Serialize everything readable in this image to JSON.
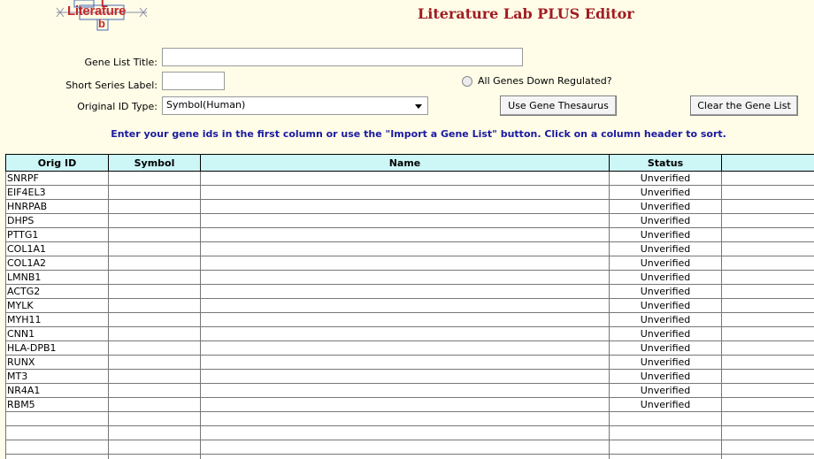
{
  "logo": {
    "word": "Literature",
    "top_letter": "L",
    "bottom_letter": "b"
  },
  "app_title": "Literature Lab PLUS Editor",
  "form": {
    "gene_list_title_label": "Gene List Title:",
    "gene_list_title_value": "",
    "short_series_label": "Short Series Label:",
    "short_series_value": "",
    "original_id_type_label": "Original ID Type:",
    "original_id_type_value": "Symbol(Human)",
    "all_genes_down_label": "All Genes Down Regulated?"
  },
  "buttons": {
    "use_gene_thesaurus": "Use Gene Thesaurus",
    "clear_gene_list": "Clear the Gene List"
  },
  "instruction": "Enter your gene ids in the first column or use the \"Import a Gene List\" button.  Click on a column header to sort.",
  "table": {
    "columns": [
      "Orig ID",
      "Symbol",
      "Name",
      "Status",
      ""
    ],
    "rows": [
      [
        "SNRPF",
        "",
        "",
        "Unverified",
        ""
      ],
      [
        "EIF4EL3",
        "",
        "",
        "Unverified",
        ""
      ],
      [
        "HNRPAB",
        "",
        "",
        "Unverified",
        ""
      ],
      [
        "DHPS",
        "",
        "",
        "Unverified",
        ""
      ],
      [
        "PTTG1",
        "",
        "",
        "Unverified",
        ""
      ],
      [
        "COL1A1",
        "",
        "",
        "Unverified",
        ""
      ],
      [
        "COL1A2",
        "",
        "",
        "Unverified",
        ""
      ],
      [
        "LMNB1",
        "",
        "",
        "Unverified",
        ""
      ],
      [
        "ACTG2",
        "",
        "",
        "Unverified",
        ""
      ],
      [
        "MYLK",
        "",
        "",
        "Unverified",
        ""
      ],
      [
        "MYH11",
        "",
        "",
        "Unverified",
        ""
      ],
      [
        "CNN1",
        "",
        "",
        "Unverified",
        ""
      ],
      [
        "HLA-DPB1",
        "",
        "",
        "Unverified",
        ""
      ],
      [
        "RUNX",
        "",
        "",
        "Unverified",
        ""
      ],
      [
        "MT3",
        "",
        "",
        "Unverified",
        ""
      ],
      [
        "NR4A1",
        "",
        "",
        "Unverified",
        ""
      ],
      [
        "RBM5",
        "",
        "",
        "Unverified",
        ""
      ],
      [
        "",
        "",
        "",
        "",
        ""
      ],
      [
        "",
        "",
        "",
        "",
        ""
      ],
      [
        "",
        "",
        "",
        "",
        ""
      ],
      [
        "",
        "",
        "",
        "",
        ""
      ]
    ]
  }
}
